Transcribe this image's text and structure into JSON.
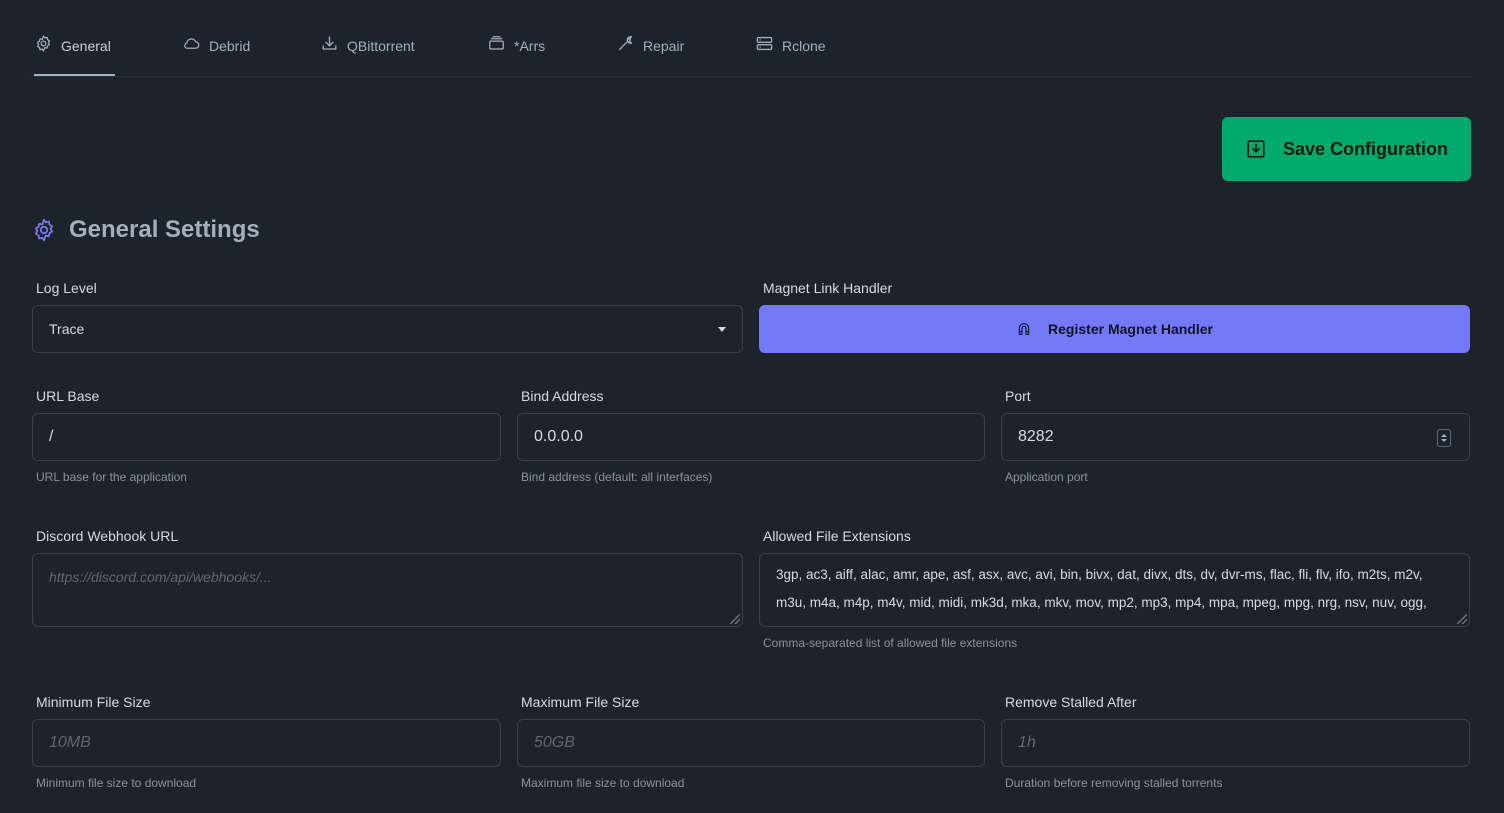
{
  "tabs": [
    {
      "label": "General",
      "icon": "gear-icon",
      "active": true
    },
    {
      "label": "Debrid",
      "icon": "cloud-icon"
    },
    {
      "label": "QBittorrent",
      "icon": "download-icon"
    },
    {
      "label": "*Arrs",
      "icon": "stack-icon"
    },
    {
      "label": "Repair",
      "icon": "wrench-icon"
    },
    {
      "label": "Rclone",
      "icon": "server-icon"
    }
  ],
  "toolbar": {
    "save_label": "Save Configuration"
  },
  "section": {
    "title": "General Settings"
  },
  "log_level": {
    "label": "Log Level",
    "value": "Trace"
  },
  "magnet": {
    "label": "Magnet Link Handler",
    "button_label": "Register Magnet Handler"
  },
  "url_base": {
    "label": "URL Base",
    "value": "/",
    "hint": "URL base for the application"
  },
  "bind_address": {
    "label": "Bind Address",
    "value": "0.0.0.0",
    "hint": "Bind address (default: all interfaces)"
  },
  "port": {
    "label": "Port",
    "value": "8282",
    "hint": "Application port"
  },
  "discord": {
    "label": "Discord Webhook URL",
    "placeholder": "https://discord.com/api/webhooks/..."
  },
  "extensions": {
    "label": "Allowed File Extensions",
    "value": "3gp, ac3, aiff, alac, amr, ape, asf, asx, avc, avi, bin, bivx, dat, divx, dts, dv, dvr-ms, flac, fli, flv, ifo, m2ts, m2v, m3u, m4a, m4p, m4v, mid, midi, mk3d, mka, mkv, mov, mp2, mp3, mp4, mpa, mpeg, mpg, nrg, nsv, nuv, ogg,",
    "hint": "Comma-separated list of allowed file extensions"
  },
  "min_size": {
    "label": "Minimum File Size",
    "placeholder": "10MB",
    "hint": "Minimum file size to download"
  },
  "max_size": {
    "label": "Maximum File Size",
    "placeholder": "50GB",
    "hint": "Maximum file size to download"
  },
  "stalled": {
    "label": "Remove Stalled After",
    "placeholder": "1h",
    "hint": "Duration before removing stalled torrents"
  },
  "colors": {
    "background": "#1d232a",
    "primary": "#7479f8",
    "success": "#00a96e"
  }
}
